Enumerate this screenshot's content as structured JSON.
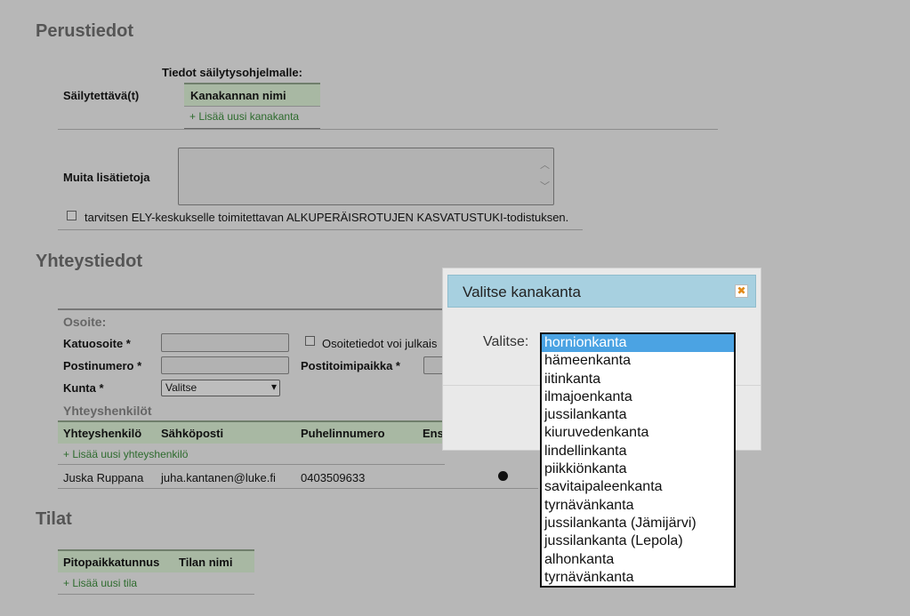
{
  "perustiedot": {
    "title": "Perustiedot",
    "sailytettava_label": "Säilytettävä(t)",
    "tiedot_label": "Tiedot säilytysohjelmalle:",
    "kanakanta_header": "Kanakannan nimi",
    "add_kanakanta": "+ Lisää uusi kanakanta",
    "muita_label": "Muita lisätietoja",
    "ely_checkbox_label": "tarvitsen ELY-keskukselle toimitettavan ALKUPERÄISROTUJEN KASVATUSTUKI-todistuksen."
  },
  "yhteystiedot": {
    "title": "Yhteystiedot",
    "osoite_heading": "Osoite:",
    "katuosoite_label": "Katuosoite *",
    "osoitetiedot_checkbox": "Osoitetiedot voi julkais",
    "postinumero_label": "Postinumero *",
    "postitoimipaikka_label": "Postitoimipaikka *",
    "kunta_label": "Kunta *",
    "kunta_value": "Valitse",
    "yhteyshenkilot_heading": "Yhteyshenkilöt",
    "columns": [
      "Yhteyshenkilö",
      "Sähköposti",
      "Puhelinnumero",
      "Ens"
    ],
    "add_contact": "+ Lisää uusi yhteyshenkilö",
    "contacts": [
      {
        "name": "Juska Ruppana",
        "email": "juha.kantanen@luke.fi",
        "phone": "0403509633"
      }
    ]
  },
  "tilat": {
    "title": "Tilat",
    "columns": [
      "Pitopaikkatunnus",
      "Tilan nimi"
    ],
    "add_tila": "+ Lisää uusi tila"
  },
  "dialog": {
    "title": "Valitse kanakanta",
    "close_icon": "close-x-icon",
    "valitse_label": "Valitse:",
    "options": [
      "hornionkanta",
      "hämeenkanta",
      "iitinkanta",
      "ilmajoenkanta",
      "jussilankanta",
      "kiuruvedenkanta",
      "lindellinkanta",
      "piikkiönkanta",
      "savitaipaleenkanta",
      "tyrnävänkanta",
      "jussilankanta (Jämijärvi)",
      "jussilankanta (Lepola)",
      "alhonkanta",
      "tyrnävänkanta"
    ],
    "selected_option": "hornionkanta"
  },
  "colors": {
    "overlay_background": "#b7b7b7",
    "dialog_title_bar": "#a7d0e0",
    "selected_option": "#4ba3e3",
    "link_green": "#2d6b2d",
    "close_icon_orange": "#e28a18"
  }
}
